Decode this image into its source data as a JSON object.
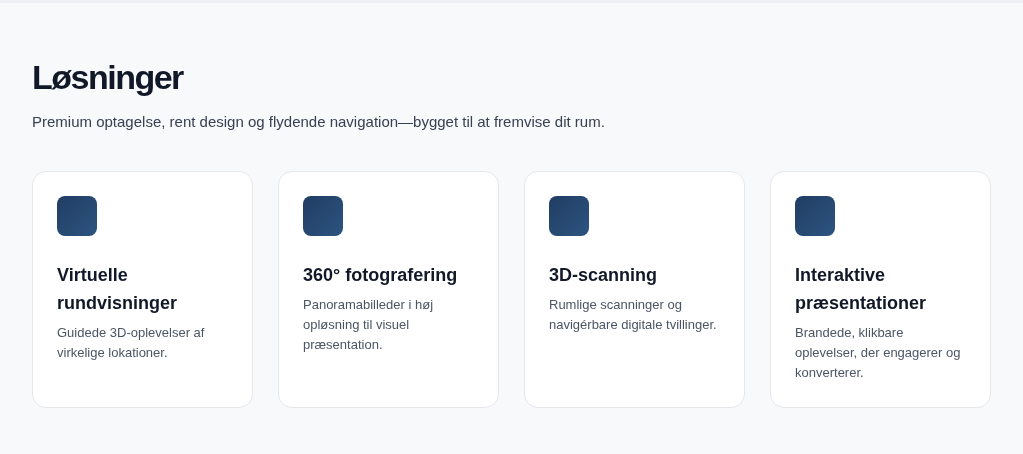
{
  "heading": "Løsninger",
  "subtitle": "Premium optagelse, rent design og flydende navigation—bygget til at fremvise dit rum.",
  "cards": [
    {
      "title": "Virtuelle rundvisninger",
      "description": "Guidede 3D-oplevelser af virkelige lokationer."
    },
    {
      "title": "360° fotografering",
      "description": "Panoramabilleder i høj opløsning til visuel præsentation."
    },
    {
      "title": "3D-scanning",
      "description": "Rumlige scanninger og navigérbare digitale tvillinger."
    },
    {
      "title": "Interaktive præsentationer",
      "description": "Brandede, klikbare oplevelser, der engagerer og konverterer."
    }
  ]
}
